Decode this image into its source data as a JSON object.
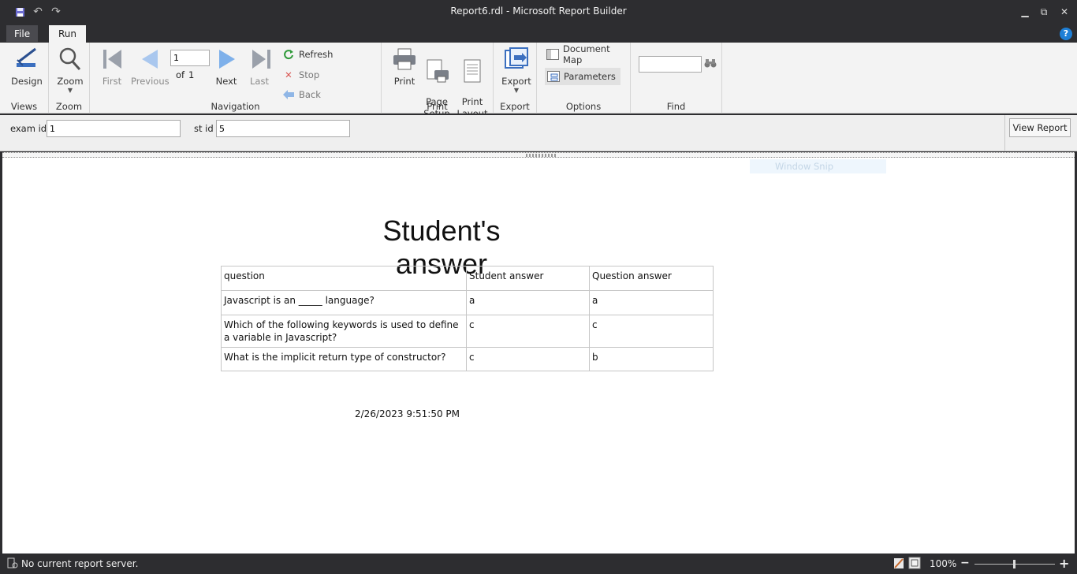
{
  "window": {
    "title": "Report6.rdl - Microsoft Report Builder"
  },
  "tabs": {
    "file": "File",
    "run": "Run",
    "help": "?"
  },
  "ribbon": {
    "views": {
      "label": "Views",
      "design": "Design"
    },
    "zoom": {
      "label": "Zoom",
      "zoom": "Zoom"
    },
    "navigation": {
      "label": "Navigation",
      "first": "First",
      "previous": "Previous",
      "next": "Next",
      "last": "Last",
      "page_value": "1",
      "of_label": "of",
      "page_count": "1",
      "refresh": "Refresh",
      "stop": "Stop",
      "back": "Back"
    },
    "print": {
      "label": "Print",
      "print": "Print",
      "page_setup": "Page\nSetup",
      "print_layout": "Print\nLayout"
    },
    "export": {
      "label": "Export",
      "export": "Export"
    },
    "options": {
      "label": "Options",
      "document_map": "Document Map",
      "parameters": "Parameters"
    },
    "find": {
      "label": "Find",
      "value": ""
    }
  },
  "parameters": {
    "exam_id": {
      "label": "exam id",
      "value": "1"
    },
    "st_id": {
      "label": "st id",
      "value": "5"
    },
    "view_report": "View Report"
  },
  "report": {
    "ghost_text": "Window Snip",
    "title": "Student's answer",
    "headers": [
      "question",
      "Student answer",
      "Question answer"
    ],
    "rows": [
      [
        "Javascript is an _____ language?",
        "a",
        "a"
      ],
      [
        "Which of the following keywords is used to define a variable in Javascript?",
        "c",
        "c"
      ],
      [
        "What is the implicit return type of constructor?",
        "c",
        "b"
      ]
    ],
    "date": "2/26/2023 9:51:50 PM"
  },
  "status": {
    "text": "No current report server.",
    "zoom": "100%"
  }
}
